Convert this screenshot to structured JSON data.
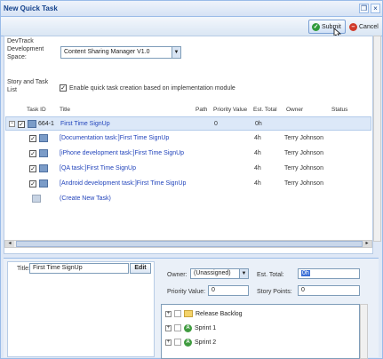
{
  "window": {
    "title": "New Quick Task"
  },
  "toolbar": {
    "submit_label": "Submit",
    "cancel_label": "Cancel"
  },
  "form": {
    "devspace_label": "DevTrack Development Space:",
    "devspace_value": "Content Sharing Manager V1.0",
    "story_label": "Story and Task List",
    "enable_label": "Enable quick task creation based on implementation module"
  },
  "grid": {
    "headers": [
      "Task ID",
      "Title",
      "Path",
      "Priority Value",
      "Est. Total",
      "Owner",
      "Status"
    ],
    "rows": [
      {
        "id": "664-1",
        "title": "First Time SignUp",
        "priority": "0",
        "est": "0h",
        "owner": ""
      },
      {
        "id": "",
        "title": "[Documentation task:]First Time SignUp",
        "priority": "",
        "est": "4h",
        "owner": "Terry Johnson"
      },
      {
        "id": "",
        "title": "[iPhone development task:]First Time SignUp",
        "priority": "",
        "est": "4h",
        "owner": "Terry Johnson"
      },
      {
        "id": "",
        "title": "[QA task:]First Time SignUp",
        "priority": "",
        "est": "4h",
        "owner": "Terry Johnson"
      },
      {
        "id": "",
        "title": "[Android development task:]First Time SignUp",
        "priority": "",
        "est": "4h",
        "owner": "Terry Johnson"
      },
      {
        "id": "",
        "title": "(Create New Task)",
        "priority": "",
        "est": "",
        "owner": ""
      }
    ]
  },
  "detail": {
    "title_label": "Title:",
    "title_value": "First Time SignUp",
    "edit_label": "Edit",
    "owner_label": "Owner:",
    "owner_value": "(Unassigned)",
    "est_label": "Est. Total:",
    "est_value": "0h",
    "priority_label": "Priority Value:",
    "priority_value": "0",
    "story_points_label": "Story Points:",
    "story_points_value": "0"
  },
  "tree": {
    "items": [
      {
        "label": "Release Backlog"
      },
      {
        "label": "Sprint 1"
      },
      {
        "label": "Sprint 2"
      }
    ]
  }
}
